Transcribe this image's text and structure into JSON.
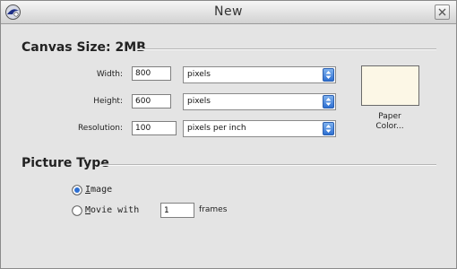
{
  "window": {
    "title": "New"
  },
  "canvas": {
    "section_title": "Canvas Size: 2MB",
    "width_label": "Width:",
    "width_value": "800",
    "width_unit": "pixels",
    "height_label": "Height:",
    "height_value": "600",
    "height_unit": "pixels",
    "resolution_label": "Resolution:",
    "resolution_value": "100",
    "resolution_unit": "pixels per inch",
    "paper_color": "#fcf7e6",
    "paper_label_line1": "Paper",
    "paper_label_line2": "Color..."
  },
  "picture_type": {
    "section_title": "Picture Type",
    "image_label_first": "I",
    "image_label_rest": "mage",
    "image_selected": true,
    "movie_label_first": "M",
    "movie_label_rest": "ovie with",
    "movie_selected": false,
    "frames_value": "1",
    "frames_label": "frames"
  },
  "colors": {
    "accent": "#2d6fd2"
  }
}
